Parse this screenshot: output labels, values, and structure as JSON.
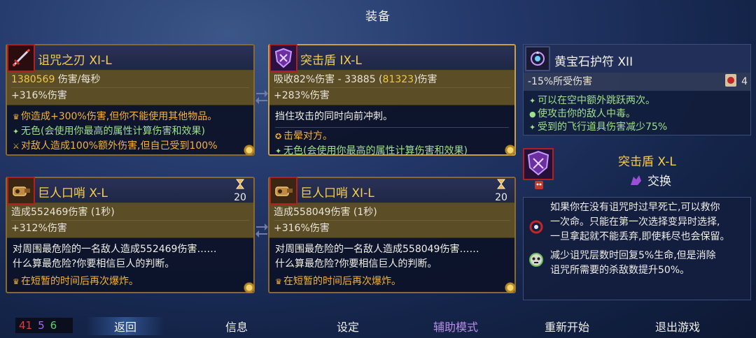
{
  "title": "装备",
  "cards": [
    {
      "name": "诅咒之刃 XI-L",
      "stat1_value": "1380569",
      "stat1_rest": " 伤害/每秒",
      "stat2": "+316%伤害",
      "traits": [
        "你造成+300%伤害,但你不能使用其他物品。",
        "无色(会使用你最高的属性计算伤害和效果)",
        "对敌人造成100%额外伤害,但自己受到100%"
      ]
    },
    {
      "name": "突击盾 IX-L",
      "stat1_pre": "吸收82%伤害 - 33885 (",
      "stat1_value": "81323",
      "stat1_post": ")伤害",
      "stat2": "+283%伤害",
      "desc": "挡住攻击的同时向前冲刺。",
      "traits": [
        "击晕对方。",
        "无色(会使用你最高的属性计算伤害和效果)"
      ]
    },
    {
      "name": "巨人口哨 X-L",
      "charges": "20",
      "stat1": "造成552469伤害 (1秒)",
      "stat2": "+312%伤害",
      "desc": [
        "对周围最危险的一名敌人造成552469伤害……",
        "什么算最危险?你要相信巨人的判断。"
      ],
      "traits": [
        "在短暂的时间后再次爆炸。"
      ]
    },
    {
      "name": "巨人口哨 XI-L",
      "charges": "20",
      "stat1": "造成558049伤害 (1秒)",
      "stat2": "+316%伤害",
      "desc": [
        "对周围最危险的一名敌人造成558049伤害……",
        "什么算最危险?你要相信巨人的判断。"
      ],
      "traits": [
        "在短暂的时间后再次爆炸。"
      ]
    }
  ],
  "amulet": {
    "name": "黄宝石护符 XII",
    "stat": "-15%所受伤害",
    "scroll_count": "4",
    "traits": [
      "可以在空中额外跳跃两次。",
      "使攻击你的敌人中毒。",
      "受到的飞行道具伤害减少75%"
    ]
  },
  "swap": {
    "name": "突击盾 X-L",
    "action": "交换",
    "rows": [
      [
        "如果你在没有诅咒时过早死亡,可以救你",
        "一次命。只能在第一次选择变异时选择,",
        "一旦拿起就不能丢弃,即使耗尽也会保留。"
      ],
      [
        "减少诅咒层数时回复5%生命,但是消除",
        "诅咒所需要的杀敌数提升50%。"
      ]
    ]
  },
  "counters": {
    "red": "41",
    "purple": "5",
    "green": "6"
  },
  "menu": [
    "返回",
    "信息",
    "设定",
    "辅助模式",
    "重新开始",
    "退出游戏"
  ],
  "colors": {
    "gold_title": "#f7cd4a",
    "stat_highlight": "#f0c946",
    "trait_orange": "#f5b23a",
    "trait_green": "#9fe08c",
    "assist_purple": "#b98ee8",
    "counter_red": "#e03a3a",
    "counter_purple": "#a56bdf",
    "counter_green": "#5ed06a"
  }
}
